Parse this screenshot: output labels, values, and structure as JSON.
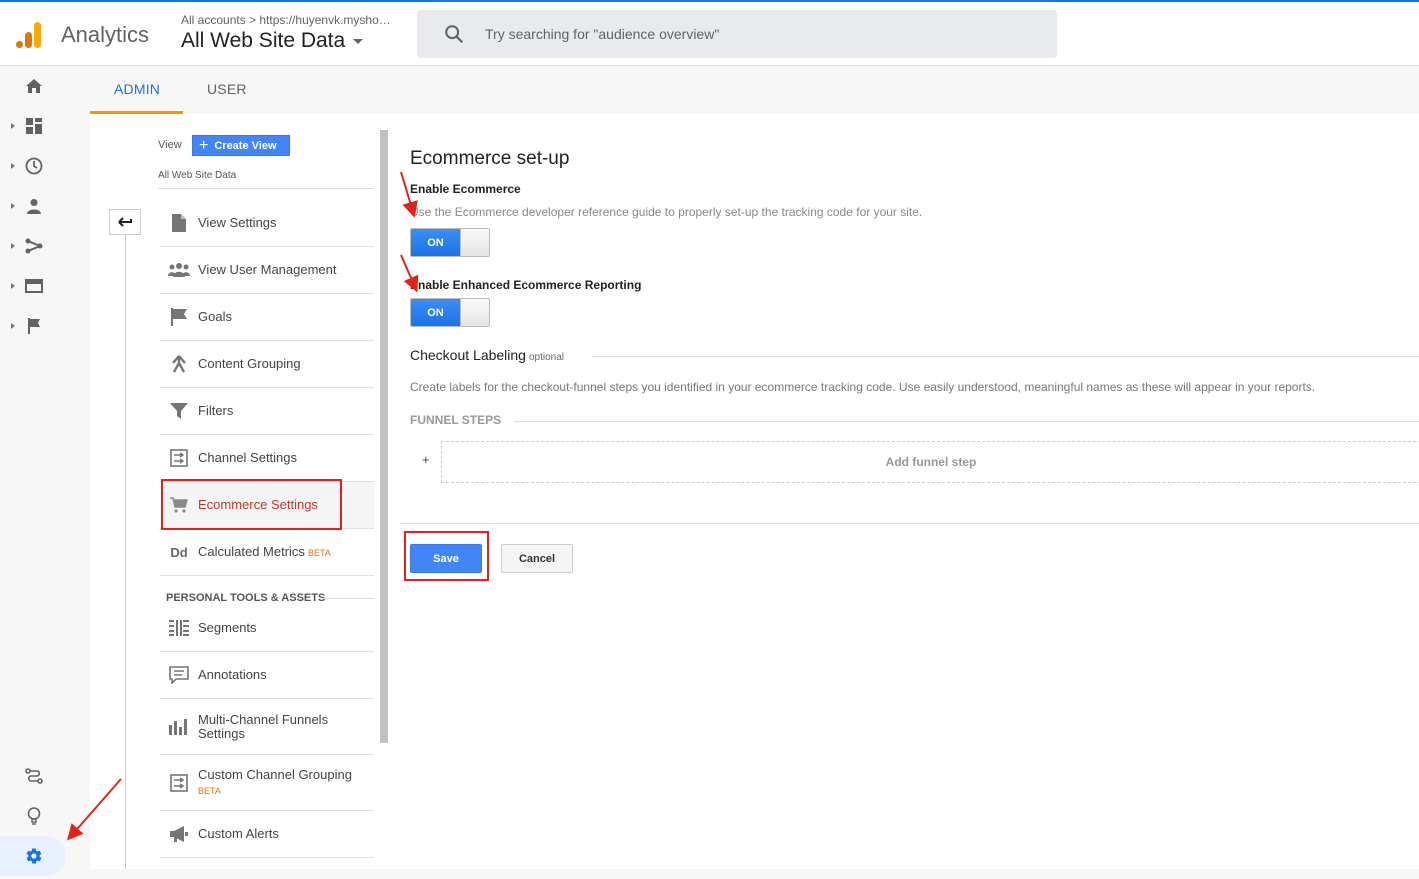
{
  "header": {
    "app_name": "Analytics",
    "breadcrumb": "All accounts  >  https://huyenvk.mysho…",
    "property": "All Web Site Data",
    "search_placeholder": "Try searching for \"audience overview\""
  },
  "tabs": {
    "admin": "ADMIN",
    "user": "USER"
  },
  "view_column": {
    "view_label": "View",
    "create_view": "Create View",
    "view_name": "All Web Site Data",
    "items": [
      {
        "label": "View Settings",
        "icon": "document-icon"
      },
      {
        "label": "View User Management",
        "icon": "people-icon"
      },
      {
        "label": "Goals",
        "icon": "flag-icon"
      },
      {
        "label": "Content Grouping",
        "icon": "content-grouping-icon"
      },
      {
        "label": "Filters",
        "icon": "filter-icon"
      },
      {
        "label": "Channel Settings",
        "icon": "channel-icon"
      },
      {
        "label": "Ecommerce Settings",
        "icon": "cart-icon"
      },
      {
        "label": "Calculated Metrics",
        "icon": "dd-icon",
        "badge": "BETA"
      }
    ],
    "section_title": "PERSONAL TOOLS & ASSETS",
    "tools": [
      {
        "label": "Segments",
        "icon": "segments-icon"
      },
      {
        "label": "Annotations",
        "icon": "annotation-icon"
      },
      {
        "label": "Multi-Channel Funnels",
        "label2": "Settings",
        "icon": "bar-chart-icon"
      },
      {
        "label": "Custom Channel Grouping",
        "icon": "channel-icon",
        "badge": "BETA"
      },
      {
        "label": "Custom Alerts",
        "icon": "megaphone-icon"
      }
    ]
  },
  "ecommerce": {
    "title": "Ecommerce set-up",
    "enable_label": "Enable Ecommerce",
    "enable_help": "Use the Ecommerce developer reference guide to properly set-up the tracking code for your site.",
    "enable_state": "ON",
    "enhanced_label": "Enable Enhanced Ecommerce Reporting",
    "enhanced_state": "ON",
    "checkout_title": "Checkout Labeling",
    "checkout_optional": "optional",
    "checkout_help": "Create labels for the checkout-funnel steps you identified in your ecommerce tracking code. Use easily understood, meaningful names as these will appear in your reports.",
    "funnel_heading": "FUNNEL STEPS",
    "funnel_plus": "+",
    "add_funnel": "Add funnel step",
    "save": "Save",
    "cancel": "Cancel"
  },
  "colors": {
    "accent": "#1a73e8",
    "tab_underline": "#f29900",
    "highlight_box": "#e0241c",
    "button_blue": "#4285f4"
  }
}
